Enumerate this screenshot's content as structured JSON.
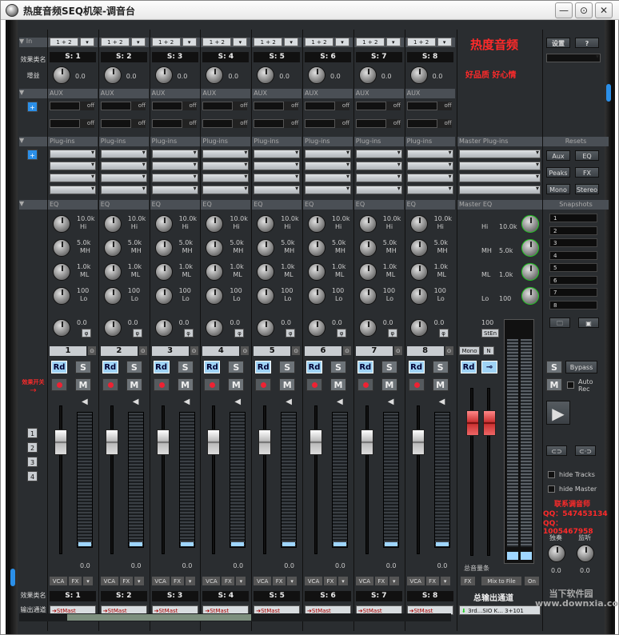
{
  "window": {
    "title": "热度音频SEQ机架-调音台",
    "min": "—",
    "restore": "⊙",
    "close": "✕"
  },
  "labels": {
    "in": "In",
    "effect_name": "效果类名",
    "gain": "增益",
    "aux": "AUX",
    "plugins": "Plug-ins",
    "master_plugins": "Master Plug-ins",
    "eq": "EQ",
    "master_eq": "Master EQ",
    "effect_switch": "效果开关",
    "effect_name_bottom": "效果类名",
    "output": "输出通道",
    "resets": "Resets",
    "snapshots": "Snapshots",
    "settings": "设置",
    "help": "?",
    "vca": "VCA",
    "fx": "FX",
    "stmast": "StMast",
    "off": "off",
    "phase": "φ",
    "mono": "Mono",
    "n": "N",
    "bypass": "Bypass",
    "auto_rec": "Auto Rec",
    "hide_tracks": "hide Tracks",
    "hide_master": "hide Master",
    "master_vol": "总音量条",
    "master_out": "总输出通道",
    "mixto_file": "Mix to File",
    "on": "On",
    "main_sel": "3rd...SIO K... 3+101",
    "solo": "独奏",
    "monitor": "监听",
    "brand": "热度音频",
    "slogan": "好品质 好心情",
    "contact": "联系调音师",
    "qq1": "QQ：547453134",
    "qq2": "QQ：1005467958",
    "rd": "Rd",
    "s": "S",
    "m": "M",
    "sten": "StEn",
    "hi": "Hi",
    "mh": "MH",
    "ml": "ML",
    "lo": "Lo",
    "zero": "0.0"
  },
  "resets": [
    "Aux",
    "EQ",
    "Peaks",
    "FX",
    "Mono",
    "Stereo"
  ],
  "snapshots": [
    "1",
    "2",
    "3",
    "4",
    "5",
    "6",
    "7",
    "8"
  ],
  "mini_buttons": [
    "1",
    "2",
    "3",
    "4"
  ],
  "channels": [
    {
      "input": "1 + 2",
      "name": "S: 1",
      "num": "1"
    },
    {
      "input": "1 + 2",
      "name": "S: 2",
      "num": "2"
    },
    {
      "input": "1 + 2",
      "name": "S: 3",
      "num": "3"
    },
    {
      "input": "1 + 2",
      "name": "S: 4",
      "num": "4"
    },
    {
      "input": "1 + 2",
      "name": "S: 5",
      "num": "5"
    },
    {
      "input": "1 + 2",
      "name": "S: 6",
      "num": "6"
    },
    {
      "input": "1 + 2",
      "name": "S: 7",
      "num": "7"
    },
    {
      "input": "1 + 2",
      "name": "S: 8",
      "num": "8"
    }
  ],
  "eq_freqs": [
    "10.0k",
    "5.0k",
    "1.0k",
    "100"
  ],
  "master_eq": [
    "10.0k",
    "5.0k",
    "1.0k",
    "100"
  ],
  "master_pan": "100",
  "meter_scale": [
    "0",
    "10",
    "20",
    "30",
    "40",
    "50",
    "60",
    "70",
    "80"
  ],
  "footer_watermark": "当下软件园 www.downxia.com"
}
